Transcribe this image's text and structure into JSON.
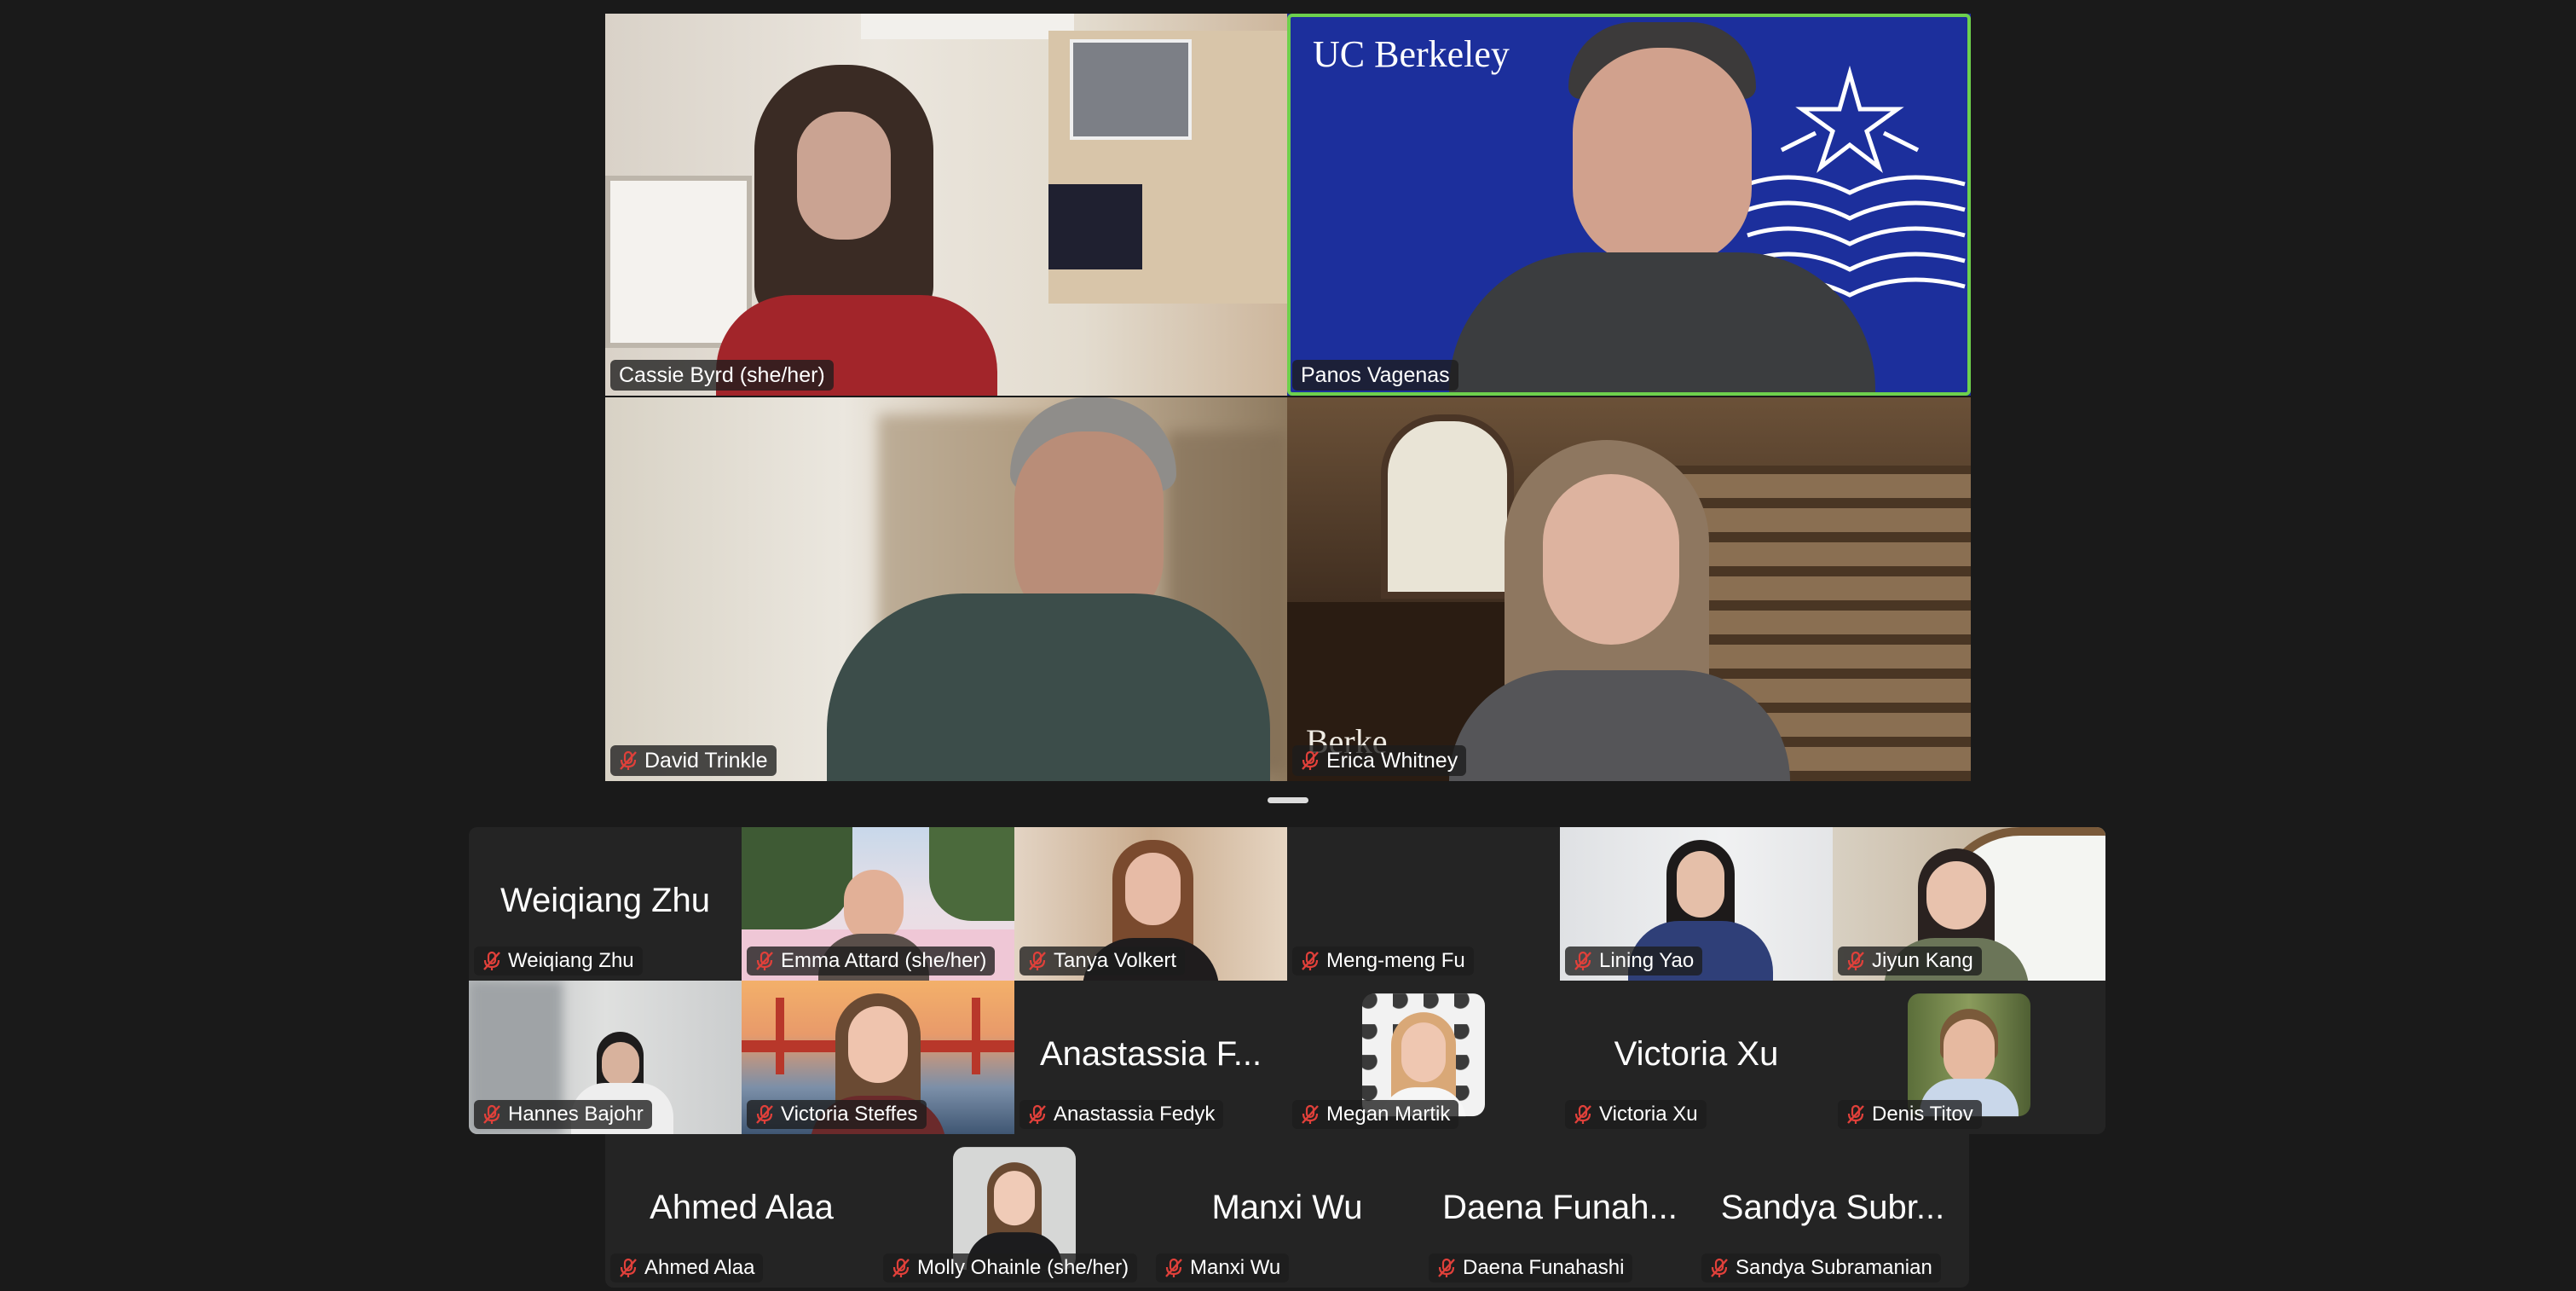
{
  "meeting": {
    "featured": [
      {
        "name": "Cassie Byrd (she/her)",
        "muted": false,
        "speaking": false
      },
      {
        "name": "Panos Vagenas",
        "muted": false,
        "speaking": true,
        "background_text": "UC Berkeley"
      },
      {
        "name": "David Trinkle",
        "muted": true,
        "speaking": false
      },
      {
        "name": "Erica Whitney",
        "muted": true,
        "speaking": false,
        "background_text": "Berke"
      }
    ],
    "gallery_row1": [
      {
        "name": "Weiqiang Zhu",
        "display": "Weiqiang Zhu",
        "muted": true
      },
      {
        "name": "Emma Attard (she/her)",
        "muted": true
      },
      {
        "name": "Tanya Volkert",
        "muted": true
      },
      {
        "name": "Meng-meng Fu",
        "muted": true
      },
      {
        "name": "Lining Yao",
        "muted": true
      },
      {
        "name": "Jiyun Kang",
        "muted": true
      }
    ],
    "gallery_row2": [
      {
        "name": "Hannes Bajohr",
        "muted": true
      },
      {
        "name": "Victoria Steffes",
        "muted": true
      },
      {
        "name": "Anastassia Fedyk",
        "display": "Anastassia F...",
        "muted": true
      },
      {
        "name": "Megan Martik",
        "muted": true
      },
      {
        "name": "Victoria Xu",
        "display": "Victoria Xu",
        "muted": true
      },
      {
        "name": "Denis Titov",
        "muted": true
      }
    ],
    "gallery_row3": [
      {
        "name": "Ahmed Alaa",
        "display": "Ahmed Alaa",
        "muted": true
      },
      {
        "name": "Molly Ohainle (she/her)",
        "muted": true
      },
      {
        "name": "Manxi Wu",
        "display": "Manxi Wu",
        "muted": true
      },
      {
        "name": "Daena Funahashi",
        "display": "Daena Funah...",
        "muted": true
      },
      {
        "name": "Sandya Subramanian",
        "display": "Sandya Subr...",
        "muted": true
      }
    ]
  },
  "colors": {
    "background": "#1a1a1a",
    "tile": "#242424",
    "active_speaker": "#6ed04d",
    "mute_icon": "#e0403a",
    "berkeley_blue": "#1c2f9c"
  }
}
